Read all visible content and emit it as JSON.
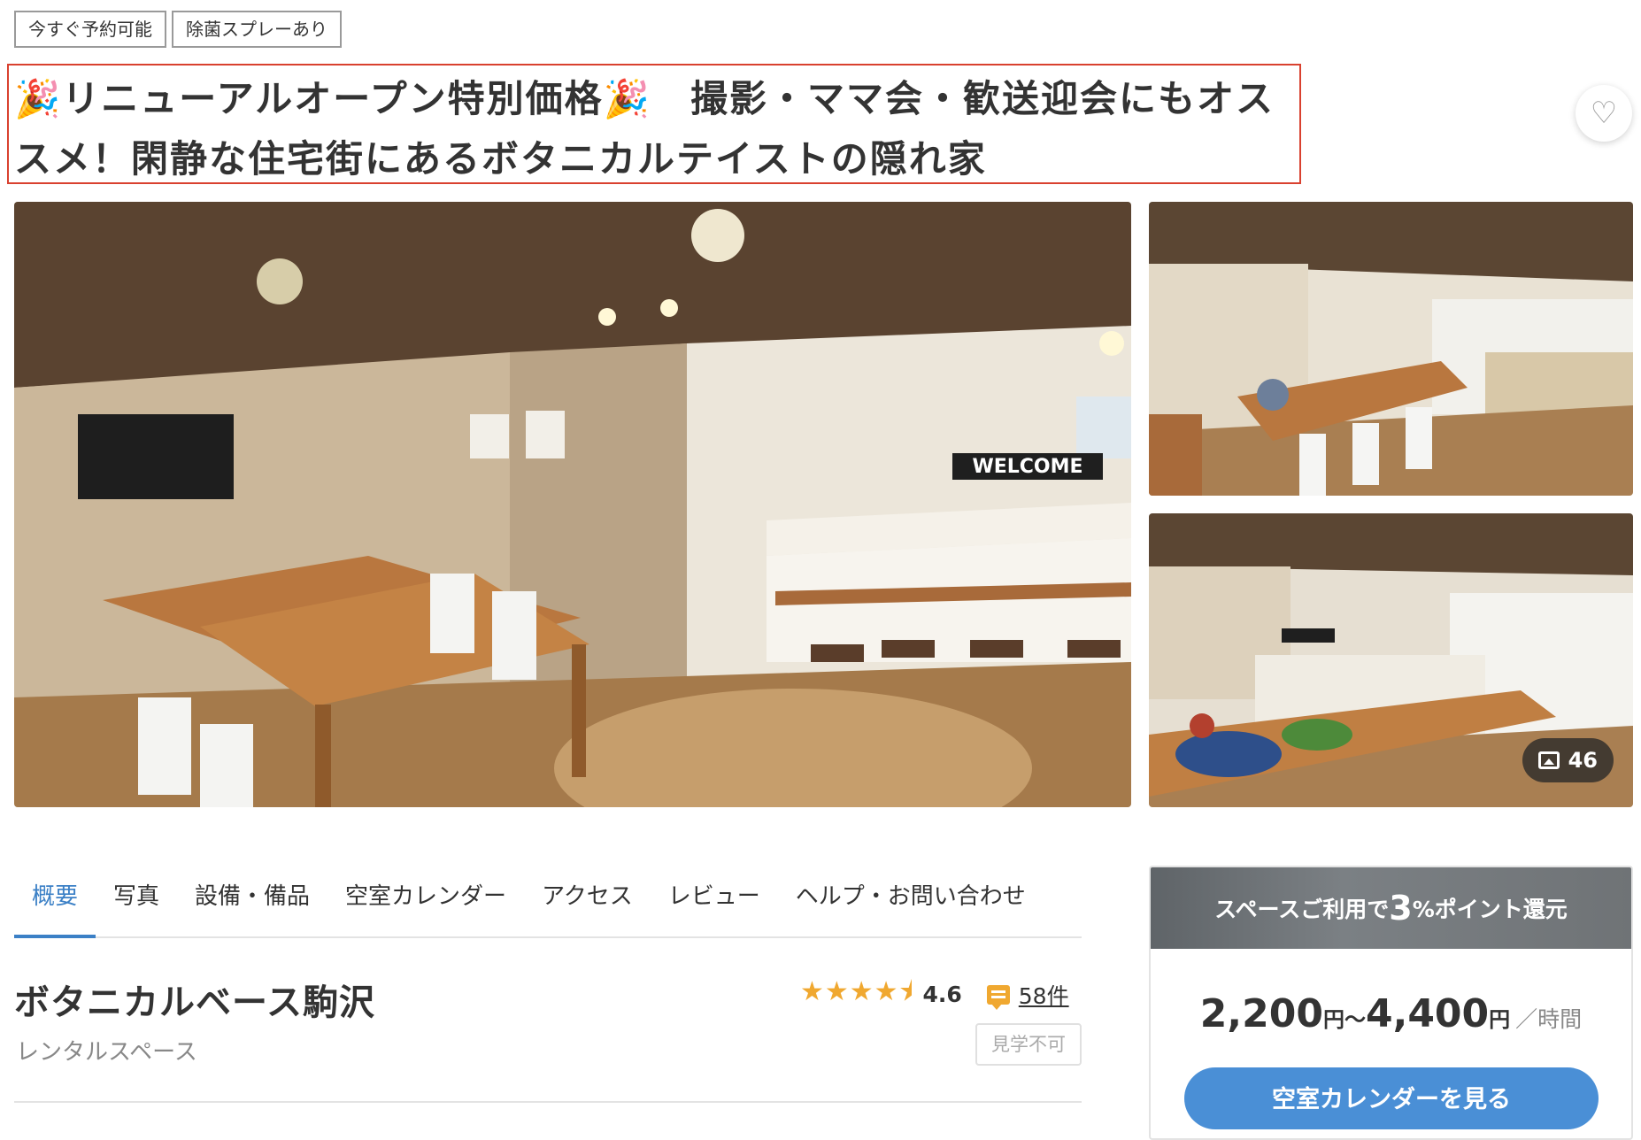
{
  "badges": [
    "今すぐ予約可能",
    "除菌スプレーあり"
  ],
  "title": "🎉リニューアルオープン特別価格🎉　撮影・ママ会・歓送迎会にもオススメ！閑静な住宅街にあるボタニカルテイストの隠れ家",
  "favorite_icon": "heart-icon",
  "gallery": {
    "photo_count": "46",
    "welcome_sign": "WELCOME"
  },
  "tabs": [
    "概要",
    "写真",
    "設備・備品",
    "空室カレンダー",
    "アクセス",
    "レビュー",
    "ヘルプ・お問い合わせ"
  ],
  "active_tab": 0,
  "space": {
    "name": "ボタニカルベース駒沢",
    "type": "レンタルスペース",
    "rating": "4.6",
    "stars": "★★★★⯨",
    "review_count": "58件",
    "tour": "見学不可"
  },
  "card": {
    "banner_prefix": "スペースご利用で",
    "banner_percent": "3",
    "banner_suffix": "%ポイント還元",
    "price_min": "2,200",
    "price_max": "4,400",
    "yen": "円",
    "tilde": "〜",
    "unit": "／時間",
    "cta": "空室カレンダーを見る"
  },
  "colors": {
    "accent": "#3b80c6",
    "button": "#4a8fd6",
    "star": "#f0a830",
    "highlight_border": "#d9412f"
  }
}
